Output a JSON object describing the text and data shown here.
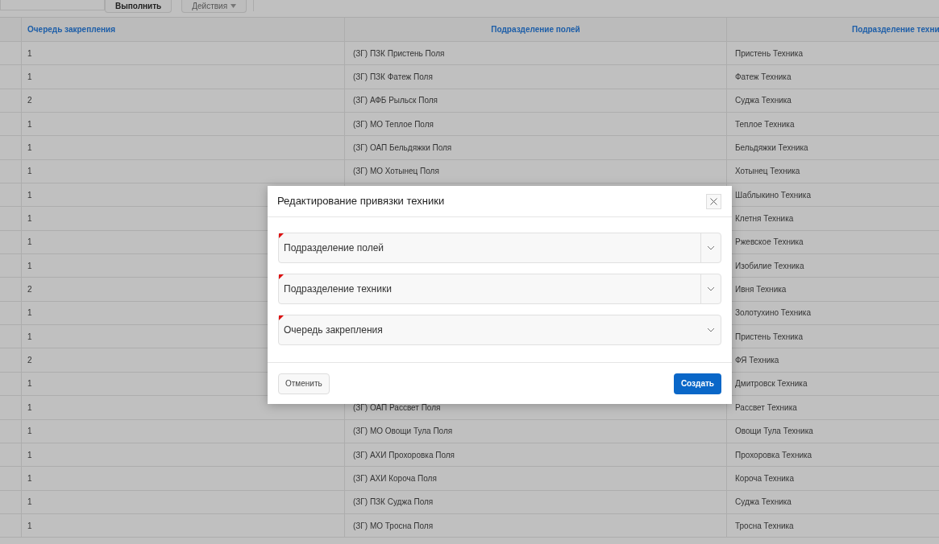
{
  "toolbar": {
    "buttons": [
      {
        "label": "Выполнить",
        "kind": "primary"
      },
      {
        "label": "Действия",
        "kind": "menu"
      }
    ]
  },
  "table": {
    "columns": [
      "Очередь закрепления",
      "Подразделение полей",
      "Подразделение техни"
    ],
    "rows": [
      {
        "queue": "1",
        "field_unit": "(ЗГ) ПЗК Пристень Поля",
        "machine_unit": "Пристень Техника"
      },
      {
        "queue": "1",
        "field_unit": "(ЗГ) ПЗК Фатеж Поля",
        "machine_unit": "Фатеж Техника"
      },
      {
        "queue": "2",
        "field_unit": "(ЗГ) АФБ Рыльск Поля",
        "machine_unit": "Суджа Техника"
      },
      {
        "queue": "1",
        "field_unit": "(ЗГ) МО Теплое Поля",
        "machine_unit": "Теплое Техника"
      },
      {
        "queue": "1",
        "field_unit": "(ЗГ) ОАП Бельдяжки Поля",
        "machine_unit": "Бельдяжки Техника"
      },
      {
        "queue": "1",
        "field_unit": "(ЗГ) МО Хотынец Поля",
        "machine_unit": "Хотынец Техника"
      },
      {
        "queue": "1",
        "machine_unit": "Шаблыкино Техника"
      },
      {
        "queue": "1",
        "machine_unit": "Клетня Техника"
      },
      {
        "queue": "1",
        "machine_unit": "Ржевское Техника"
      },
      {
        "queue": "1",
        "machine_unit": "Изобилие Техника"
      },
      {
        "queue": "2",
        "machine_unit": "Ивня Техника"
      },
      {
        "queue": "1",
        "machine_unit": "Золотухино Техника"
      },
      {
        "queue": "1",
        "machine_unit": "Пристень Техника"
      },
      {
        "queue": "2",
        "machine_unit": "ФЯ Техника"
      },
      {
        "queue": "1",
        "machine_unit": "Дмитровск Техника"
      },
      {
        "queue": "1",
        "field_unit": "(ЗГ) ОАП Рассвет Поля",
        "machine_unit": "Рассвет Техника"
      },
      {
        "queue": "1",
        "field_unit": "(ЗГ) МО Овощи Тула Поля",
        "machine_unit": "Овощи Тула Техника"
      },
      {
        "queue": "1",
        "field_unit": "(ЗГ) АХИ Прохоровка Поля",
        "machine_unit": "Прохоровка Техника"
      },
      {
        "queue": "1",
        "field_unit": "(ЗГ) АХИ Короча Поля",
        "machine_unit": "Короча Техника"
      },
      {
        "queue": "1",
        "field_unit": "(ЗГ) ПЗК Суджа Поля",
        "machine_unit": "Суджа Техника"
      },
      {
        "queue": "1",
        "field_unit": "(ЗГ) МО Тросна Поля",
        "machine_unit": "Тросна Техника"
      }
    ]
  },
  "dialog": {
    "title": "Редактирование привязки техники",
    "fields": [
      {
        "label": "Подразделение полей",
        "kind": "popup",
        "required": true
      },
      {
        "label": "Подразделение техники",
        "kind": "popup",
        "required": true
      },
      {
        "label": "Очередь закрепления",
        "kind": "select",
        "required": true
      }
    ],
    "buttons": [
      {
        "label": "Отменить",
        "kind": "secondary"
      },
      {
        "label": "Создать",
        "kind": "primary"
      }
    ]
  }
}
